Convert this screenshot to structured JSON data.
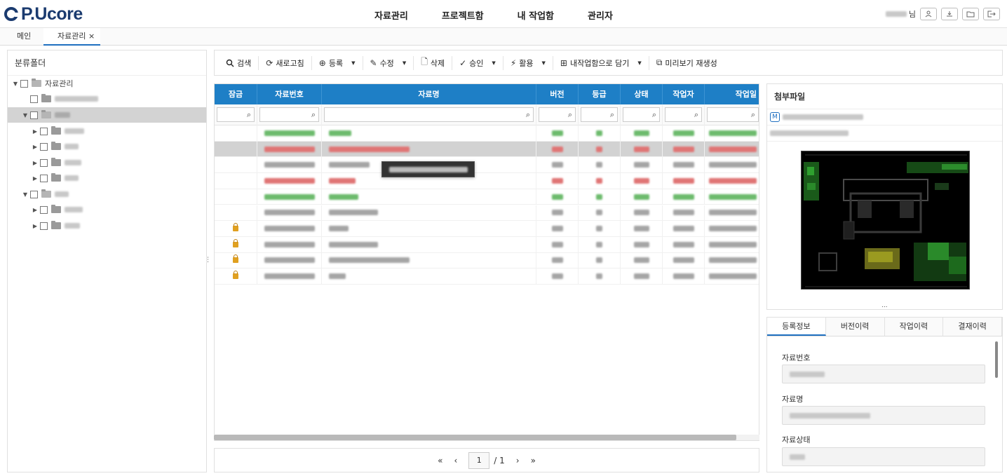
{
  "header": {
    "logo_text": "P.Ucore",
    "nav": [
      "자료관리",
      "프로젝트함",
      "내 작업함",
      "관리자"
    ],
    "user_suffix": "님"
  },
  "tabs": [
    {
      "label": "메인"
    },
    {
      "label": "자료관리 ×"
    }
  ],
  "tree": {
    "title": "분류폴더",
    "root_label": "자료관리"
  },
  "toolbar": {
    "search": "검색",
    "refresh": "새로고침",
    "register": "등록",
    "edit": "수정",
    "delete": "삭제",
    "approve": "승인",
    "use": "활용",
    "add_to_work": "내작업함으로 담기",
    "regen_preview": "미리보기 재생성"
  },
  "grid": {
    "columns": [
      "잠금",
      "자료번호",
      "자료명",
      "버전",
      "등급",
      "상태",
      "작업자",
      "작업일"
    ],
    "rows": [
      {
        "color": "green",
        "locked": false,
        "selected": false
      },
      {
        "color": "red",
        "locked": false,
        "selected": true
      },
      {
        "color": "gray",
        "locked": false,
        "selected": false
      },
      {
        "color": "red",
        "locked": false,
        "selected": false
      },
      {
        "color": "green",
        "locked": false,
        "selected": false
      },
      {
        "color": "gray",
        "locked": false,
        "selected": false
      },
      {
        "color": "gray",
        "locked": true,
        "selected": false
      },
      {
        "color": "gray",
        "locked": true,
        "selected": false
      },
      {
        "color": "gray",
        "locked": true,
        "selected": false
      },
      {
        "color": "gray",
        "locked": true,
        "selected": false
      }
    ]
  },
  "pager": {
    "first": "«",
    "prev": "‹",
    "current_page": "1",
    "total": "/ 1",
    "next": "›",
    "last": "»"
  },
  "attachment": {
    "title": "첨부파일",
    "badge": "M",
    "more": "..."
  },
  "info": {
    "tabs": [
      "등록정보",
      "버전이력",
      "작업이력",
      "결재이력"
    ],
    "field_number": "자료번호",
    "field_name": "자료명",
    "field_status": "자료상태"
  },
  "colors": {
    "accent": "#1e7fc6",
    "logo": "#1b3b6f",
    "row_green": "#6dbb6d",
    "row_red": "#e07575",
    "row_gray": "#a5a5a5"
  }
}
